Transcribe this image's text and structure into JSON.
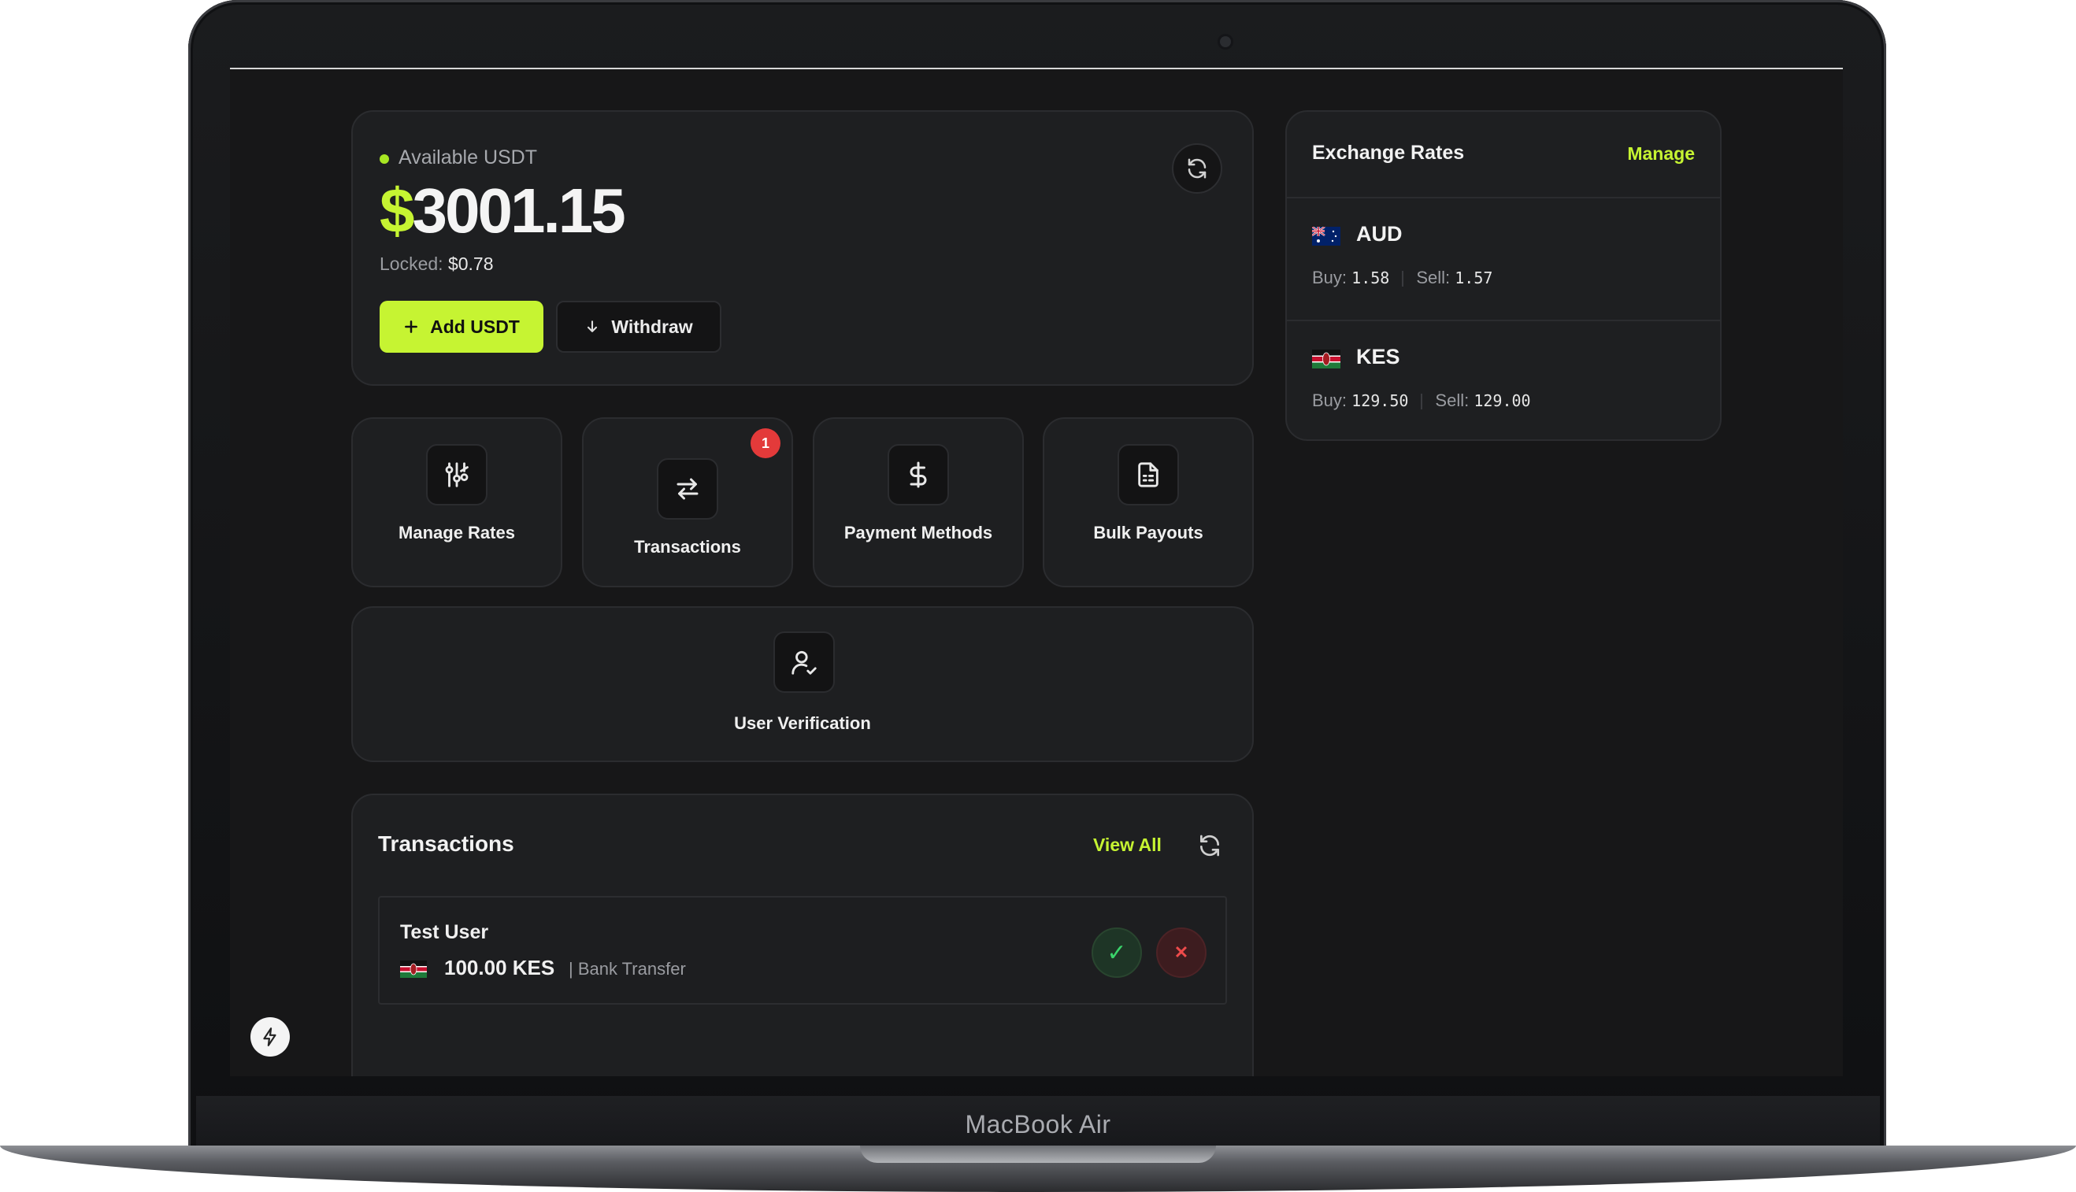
{
  "device": {
    "model_label": "MacBook Air"
  },
  "balance": {
    "available_label": "Available USDT",
    "currency_symbol": "$",
    "amount": "3001.15",
    "locked_label": "Locked:",
    "locked_value": "$0.78",
    "add_button": "Add USDT",
    "withdraw_button": "Withdraw"
  },
  "tiles": [
    {
      "label": "Manage Rates",
      "icon": "rates-icon"
    },
    {
      "label": "Transactions",
      "icon": "swap-arrows-icon",
      "badge": "1"
    },
    {
      "label": "Payment Methods",
      "icon": "dollar-icon"
    },
    {
      "label": "Bulk Payouts",
      "icon": "document-icon"
    }
  ],
  "verification": {
    "label": "User Verification",
    "icon": "user-check-icon"
  },
  "transactions": {
    "title": "Transactions",
    "view_all": "View All",
    "items": [
      {
        "name": "Test User",
        "amount": "100.00 KES",
        "method": "| Bank Transfer",
        "flag": "kenya-flag-icon"
      }
    ]
  },
  "exchange_rates": {
    "title": "Exchange Rates",
    "manage": "Manage",
    "rows": [
      {
        "code": "AUD",
        "buy_label": "Buy:",
        "buy": "1.58",
        "sell_label": "Sell:",
        "sell": "1.57",
        "flag": "australia-flag-icon"
      },
      {
        "code": "KES",
        "buy_label": "Buy:",
        "buy": "129.50",
        "sell_label": "Sell:",
        "sell": "129.00",
        "flag": "kenya-flag-icon"
      }
    ]
  },
  "colors": {
    "accent": "#c6f432",
    "background": "#171718",
    "card": "#1e1f21",
    "badge": "#e33a3a",
    "approve": "#3ad36a",
    "reject": "#ee4b4b"
  }
}
